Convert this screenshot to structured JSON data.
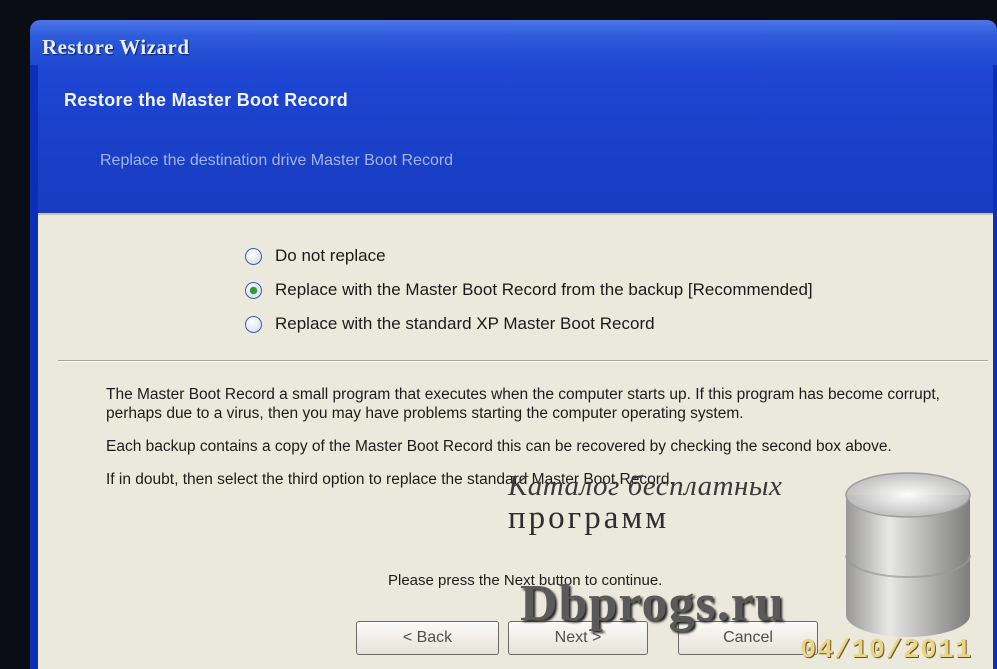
{
  "window": {
    "title": "Restore Wizard"
  },
  "header": {
    "title": "Restore the Master Boot Record",
    "subtitle": "Replace the destination drive Master Boot Record"
  },
  "options": [
    {
      "label": "Do not replace",
      "selected": false
    },
    {
      "label": "Replace with the Master Boot Record from the backup [Recommended]",
      "selected": true
    },
    {
      "label": "Replace with the standard XP Master Boot Record",
      "selected": false
    }
  ],
  "description": [
    "The Master Boot Record a small program that executes when the computer starts up. If this program has become corrupt, perhaps due to a virus, then you may have problems starting the computer operating system.",
    "Each backup contains a copy of the Master Boot Record this can be recovered by checking the second box above.",
    "If in doubt, then select the third option to replace the standard Master Boot Record."
  ],
  "continue_text": "Please press the Next button to continue.",
  "buttons": {
    "back": "< Back",
    "next": "Next >",
    "cancel": "Cancel"
  },
  "watermark": {
    "catalog": "Каталог бесплатных",
    "programs": "программ",
    "logo": "Dbprogs.ru",
    "date": "04/10/2011"
  },
  "colors": {
    "title_bar": "#2e5bdc",
    "header_band": "#1a3fc8",
    "body": "#ebe8dc",
    "radio_selected": "#2b9b3a"
  }
}
